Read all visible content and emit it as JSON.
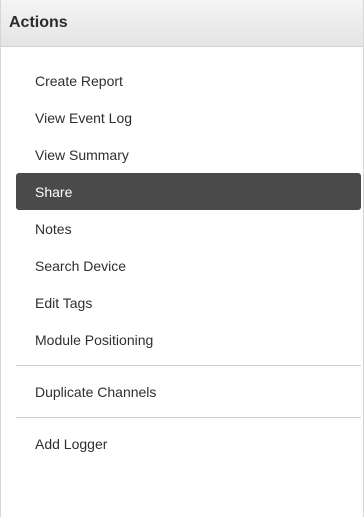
{
  "panel": {
    "title": "Actions"
  },
  "menu": {
    "items": [
      {
        "label": "Create Report"
      },
      {
        "label": "View Event Log"
      },
      {
        "label": "View Summary"
      },
      {
        "label": "Share",
        "active": true
      },
      {
        "label": "Notes"
      },
      {
        "label": "Search Device"
      },
      {
        "label": "Edit Tags"
      },
      {
        "label": "Module Positioning"
      },
      {
        "label": "Duplicate Channels"
      },
      {
        "label": "Add Logger"
      }
    ]
  },
  "colors": {
    "active_background": "#4a4a4a",
    "header_background": "#e8e8e8",
    "divider": "#cfcfcf"
  }
}
